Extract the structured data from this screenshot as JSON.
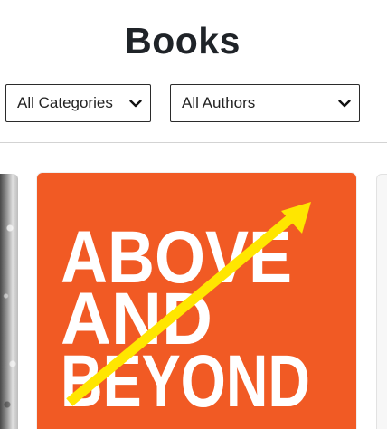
{
  "page": {
    "title": "Books"
  },
  "filters": {
    "category": {
      "selected": "All Categories"
    },
    "author": {
      "selected": "All Authors"
    }
  },
  "books": [
    {
      "cover_text": [
        "ABOVE",
        "AND",
        "BEYOND"
      ],
      "cover_color": "#f15a24",
      "arrow_color": "#ffe600",
      "text_color": "#ffffff"
    }
  ],
  "icons": {
    "dropdown": "chevron-down-icon"
  }
}
